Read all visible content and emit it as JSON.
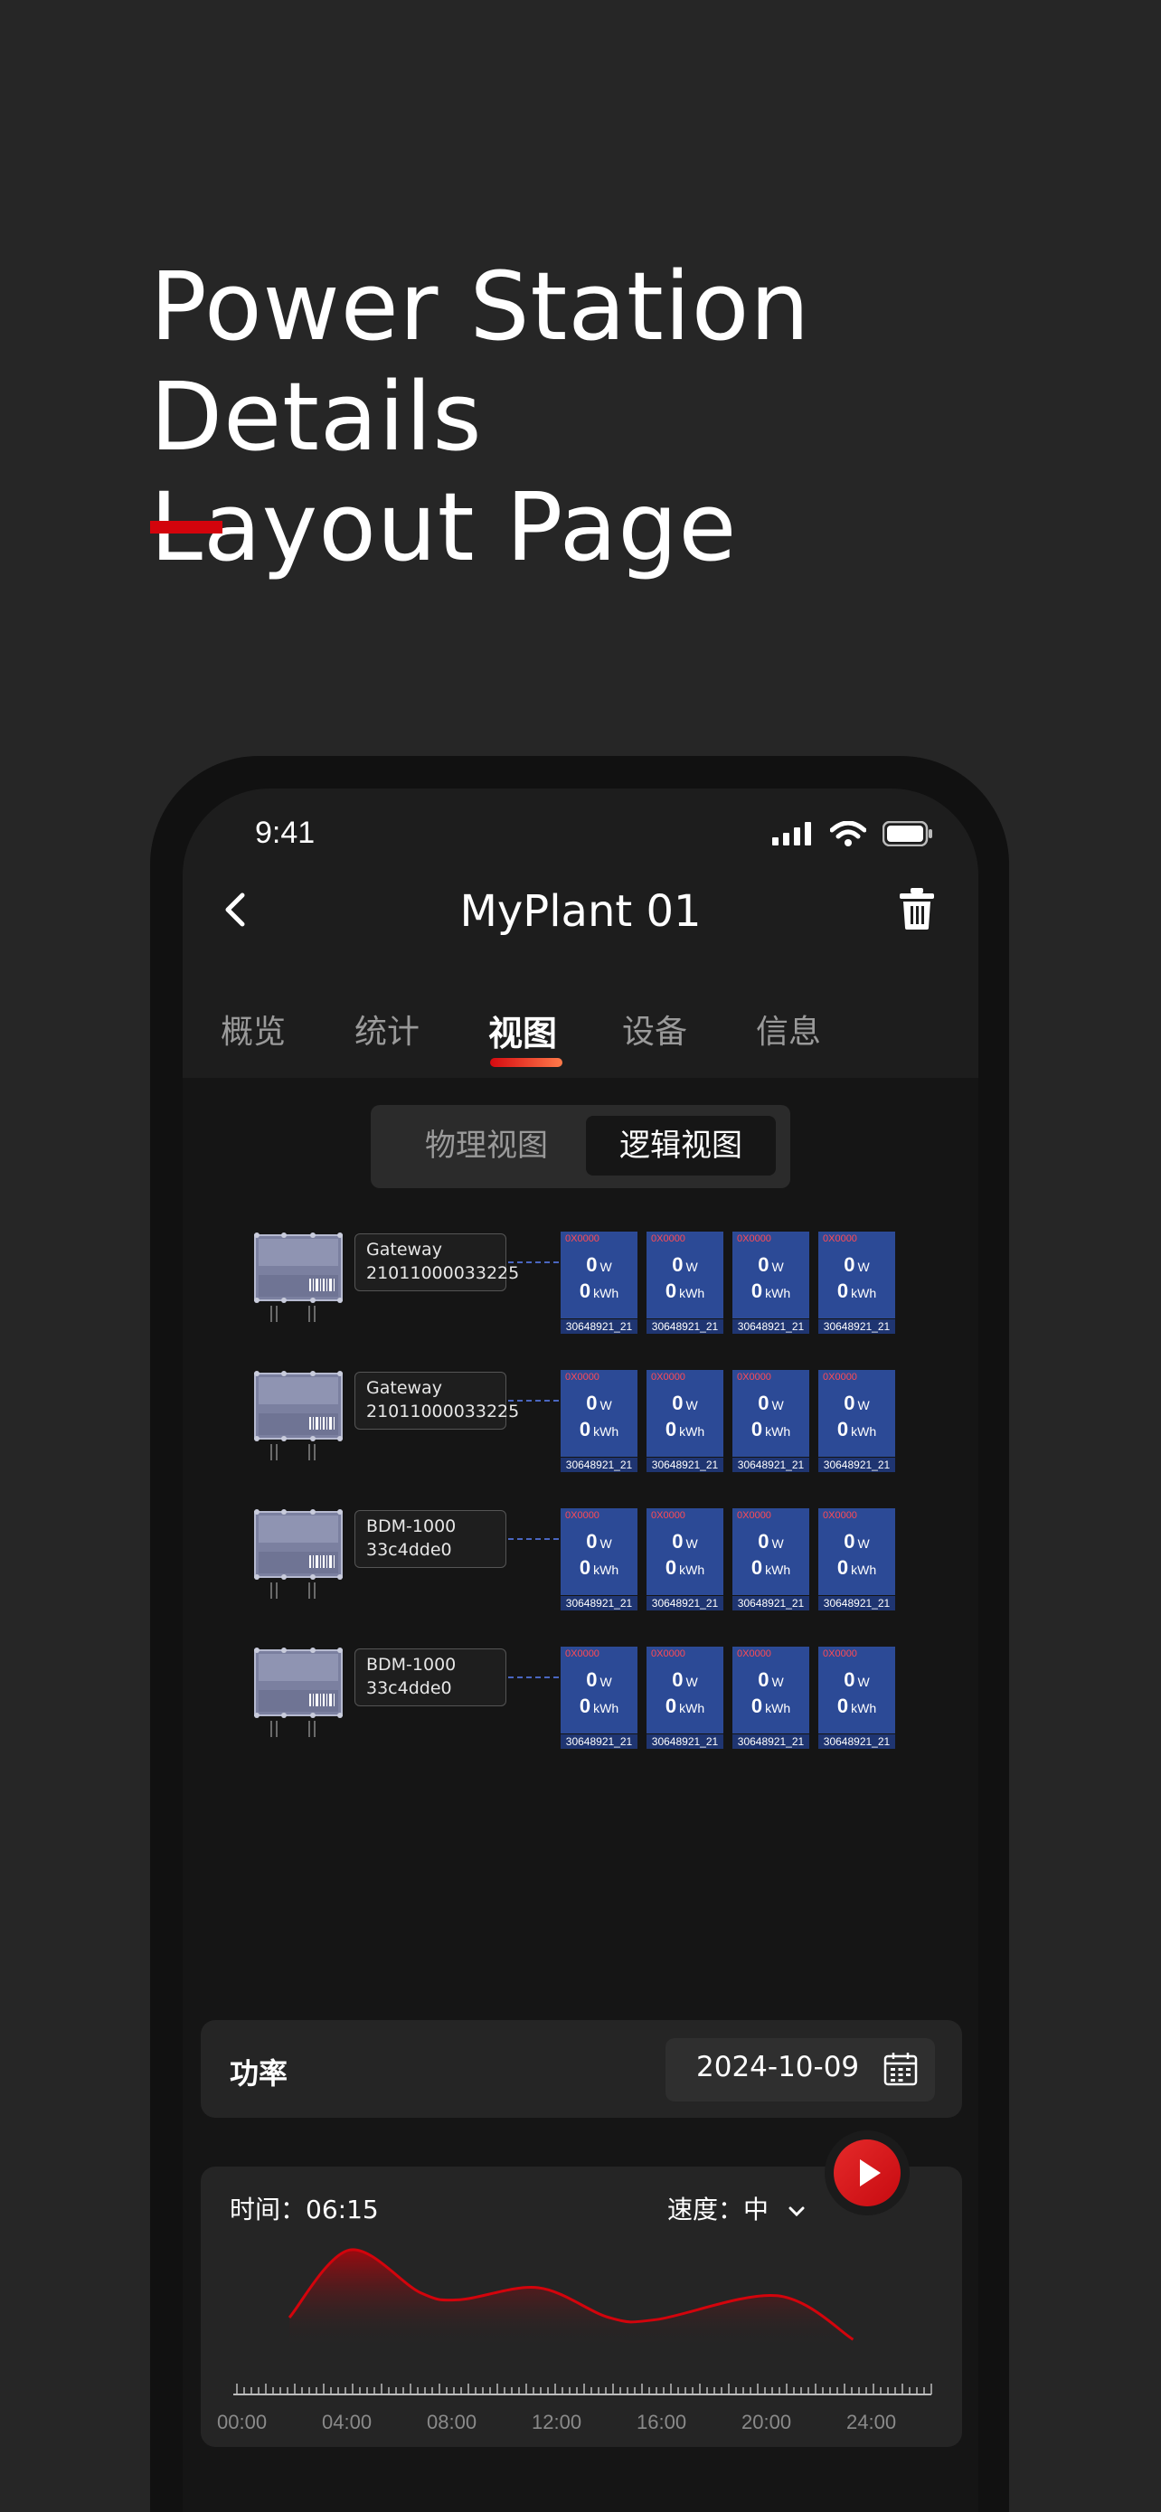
{
  "headline": {
    "line1": "Power Station Details",
    "line2": "Layout Page"
  },
  "status_bar": {
    "time": "9:41"
  },
  "nav": {
    "title": "MyPlant 01"
  },
  "tabs": [
    "概览",
    "统计",
    "视图",
    "设备",
    "信息"
  ],
  "active_tab": "视图",
  "view_toggle": {
    "physical": "物理视图",
    "logical": "逻辑视图",
    "selected": "逻辑视图"
  },
  "devices": [
    {
      "name": "Gateway",
      "sn": "21011000033225"
    },
    {
      "name": "Gateway",
      "sn": "21011000033225"
    },
    {
      "name": "BDM-1000",
      "sn": "33c4dde0"
    },
    {
      "name": "BDM-1000",
      "sn": "33c4dde0"
    }
  ],
  "module": {
    "id": "0X0000",
    "power": "0",
    "power_unit": "W",
    "energy": "0",
    "energy_unit": "kWh",
    "serial": "30648921_21"
  },
  "power_section": {
    "label": "功率",
    "date": "2024-10-09"
  },
  "playback": {
    "time_label": "时间：06:15",
    "speed_label": "速度：中"
  },
  "chart_data": {
    "type": "area",
    "x": [
      "00:00",
      "04:00",
      "08:00",
      "12:00",
      "16:00",
      "20:00",
      "24:00"
    ],
    "series": [
      {
        "points": [
          [
            2.0,
            0.3
          ],
          [
            4.3,
            0.98
          ],
          [
            7.0,
            0.55
          ],
          [
            8.5,
            0.48
          ],
          [
            11.5,
            0.6
          ],
          [
            14.2,
            0.3
          ],
          [
            16.0,
            0.28
          ],
          [
            20.6,
            0.52
          ],
          [
            23.5,
            0.08
          ]
        ]
      }
    ],
    "xlim": [
      0,
      24
    ],
    "grid": false,
    "colors": {
      "line": "#d3040c",
      "fill_top": "#b0060c",
      "axis": "#bdbdbd"
    }
  },
  "colors": {
    "accent": "#d3040c",
    "background": "#262626",
    "module_blue": "#2c4a96"
  }
}
